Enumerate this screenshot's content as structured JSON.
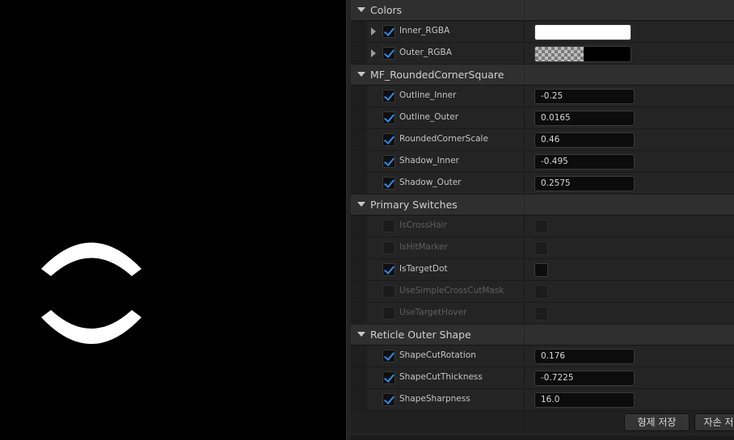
{
  "viewport": {
    "background": "#000000",
    "reticle_color": "#ffffff"
  },
  "details": {
    "categories": [
      {
        "name": "Colors",
        "properties": [
          {
            "label": "Inner_RGBA",
            "checked": true,
            "expandable": true,
            "type": "color",
            "color": "#ffffff",
            "has_alpha_checker": false
          },
          {
            "label": "Outer_RGBA",
            "checked": true,
            "expandable": true,
            "type": "color",
            "color": "#000000",
            "has_alpha_checker": true
          }
        ]
      },
      {
        "name": "MF_RoundedCornerSquare",
        "properties": [
          {
            "label": "Outline_Inner",
            "checked": true,
            "type": "number",
            "value": "-0.25"
          },
          {
            "label": "Outline_Outer",
            "checked": true,
            "type": "number",
            "value": "0.0165"
          },
          {
            "label": "RoundedCornerScale",
            "checked": true,
            "type": "number",
            "value": "0.46"
          },
          {
            "label": "Shadow_Inner",
            "checked": true,
            "type": "number",
            "value": "-0.495"
          },
          {
            "label": "Shadow_Outer",
            "checked": true,
            "type": "number",
            "value": "0.2575"
          }
        ]
      },
      {
        "name": "Primary Switches",
        "properties": [
          {
            "label": "IsCrossHair",
            "checked": false,
            "disabled": true,
            "type": "bool"
          },
          {
            "label": "IsHitMarker",
            "checked": false,
            "disabled": true,
            "type": "bool"
          },
          {
            "label": "IsTargetDot",
            "checked": true,
            "disabled": false,
            "type": "bool"
          },
          {
            "label": "UseSimpleCrossCutMask",
            "checked": false,
            "disabled": true,
            "type": "bool"
          },
          {
            "label": "UseTargetHover",
            "checked": false,
            "disabled": true,
            "type": "bool"
          }
        ]
      },
      {
        "name": "Reticle Outer Shape",
        "properties": [
          {
            "label": "ShapeCutRotation",
            "checked": true,
            "type": "number",
            "value": "0.176"
          },
          {
            "label": "ShapeCutThickness",
            "checked": true,
            "type": "number",
            "value": "-0.7225"
          },
          {
            "label": "ShapeSharpness",
            "checked": true,
            "type": "number",
            "value": "16.0"
          }
        ]
      }
    ]
  },
  "footer": {
    "buttons": [
      {
        "label": "형제 저장"
      },
      {
        "label": "자손 저"
      }
    ]
  }
}
